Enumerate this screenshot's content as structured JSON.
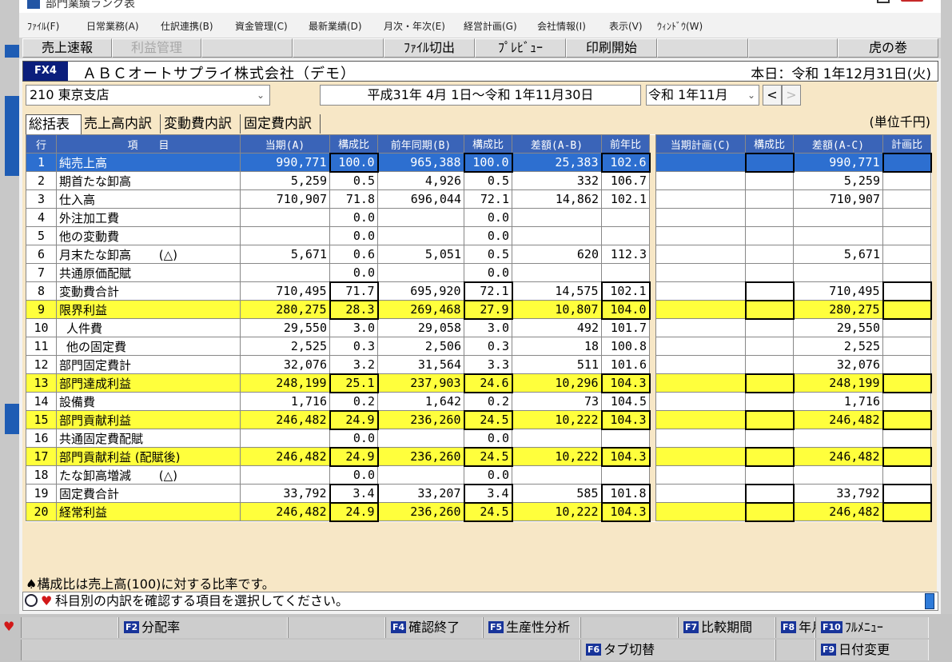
{
  "window": {
    "title": "部門業績ランク表",
    "menu": [
      "ﾌｧｲﾙ(F)",
      "日常業務(A)",
      "仕訳連携(B)",
      "資金管理(C)",
      "最新業績(D)",
      "月次・年次(E)",
      "経営計画(G)",
      "会社情報(I)",
      "表示(V)",
      "ｳｨﾝﾄﾞｳ(W)"
    ],
    "toolbar": {
      "sales_report": "売上速報",
      "profit_mgmt": "利益管理",
      "file_export": "ﾌｧｲﾙ切出",
      "preview": "ﾌﾟﾚﾋﾞｭｰ",
      "print": "印刷開始",
      "manual": "虎の巻"
    }
  },
  "company": {
    "badge": "FX4",
    "name": "ＡＢＣオートサプライ株式会社（デモ）",
    "today": "本日：令和 1年12月31日(火)"
  },
  "filters": {
    "branch": "210 東京支店",
    "period": "平成31年 4月 1日～令和 1年11月30日",
    "month": "令和 1年11月",
    "prev": "<",
    "next": ">"
  },
  "tabs": [
    "総括表",
    "売上高内訳",
    "変動費内訳",
    "固定費内訳"
  ],
  "unit": "(単位千円)",
  "table": {
    "headers": [
      "行",
      "項　　目",
      "当期(A)",
      "構成比",
      "前年同期(B)",
      "構成比",
      "差額(A-B)",
      "前年比",
      "当期計画(C)",
      "構成比",
      "差額(A-C)",
      "計画比"
    ],
    "rows": [
      {
        "no": "1",
        "item": "純売上高",
        "a": "990,771",
        "ar": "100.0",
        "b": "965,388",
        "br": "100.0",
        "ab": "25,383",
        "py": "102.6",
        "c": "",
        "cr": "",
        "ac": "990,771",
        "pr": "",
        "style": "sel"
      },
      {
        "no": "2",
        "item": "期首たな卸高",
        "a": "5,259",
        "ar": "0.5",
        "b": "4,926",
        "br": "0.5",
        "ab": "332",
        "py": "106.7",
        "c": "",
        "cr": "",
        "ac": "5,259",
        "pr": "",
        "style": ""
      },
      {
        "no": "3",
        "item": "仕入高",
        "a": "710,907",
        "ar": "71.8",
        "b": "696,044",
        "br": "72.1",
        "ab": "14,862",
        "py": "102.1",
        "c": "",
        "cr": "",
        "ac": "710,907",
        "pr": "",
        "style": ""
      },
      {
        "no": "4",
        "item": "外注加工費",
        "a": "",
        "ar": "0.0",
        "b": "",
        "br": "0.0",
        "ab": "",
        "py": "",
        "c": "",
        "cr": "",
        "ac": "",
        "pr": "",
        "style": ""
      },
      {
        "no": "5",
        "item": "他の変動費",
        "a": "",
        "ar": "0.0",
        "b": "",
        "br": "0.0",
        "ab": "",
        "py": "",
        "c": "",
        "cr": "",
        "ac": "",
        "pr": "",
        "style": ""
      },
      {
        "no": "6",
        "item": "月末たな卸高　　 (△)",
        "a": "5,671",
        "ar": "0.6",
        "b": "5,051",
        "br": "0.5",
        "ab": "620",
        "py": "112.3",
        "c": "",
        "cr": "",
        "ac": "5,671",
        "pr": "",
        "style": ""
      },
      {
        "no": "7",
        "item": "共通原価配賦",
        "a": "",
        "ar": "0.0",
        "b": "",
        "br": "0.0",
        "ab": "",
        "py": "",
        "c": "",
        "cr": "",
        "ac": "",
        "pr": "",
        "style": ""
      },
      {
        "no": "8",
        "item": "変動費合計",
        "a": "710,495",
        "ar": "71.7",
        "b": "695,920",
        "br": "72.1",
        "ab": "14,575",
        "py": "102.1",
        "c": "",
        "cr": "",
        "ac": "710,495",
        "pr": "",
        "style": "boxed"
      },
      {
        "no": "9",
        "item": "限界利益",
        "a": "280,275",
        "ar": "28.3",
        "b": "269,468",
        "br": "27.9",
        "ab": "10,807",
        "py": "104.0",
        "c": "",
        "cr": "",
        "ac": "280,275",
        "pr": "",
        "style": "yellow"
      },
      {
        "no": "10",
        "item": "人件費",
        "a": "29,550",
        "ar": "3.0",
        "b": "29,058",
        "br": "3.0",
        "ab": "492",
        "py": "101.7",
        "c": "",
        "cr": "",
        "ac": "29,550",
        "pr": "",
        "style": "indent"
      },
      {
        "no": "11",
        "item": "他の固定費",
        "a": "2,525",
        "ar": "0.3",
        "b": "2,506",
        "br": "0.3",
        "ab": "18",
        "py": "100.8",
        "c": "",
        "cr": "",
        "ac": "2,525",
        "pr": "",
        "style": "indent"
      },
      {
        "no": "12",
        "item": "部門固定費計",
        "a": "32,076",
        "ar": "3.2",
        "b": "31,564",
        "br": "3.3",
        "ab": "511",
        "py": "101.6",
        "c": "",
        "cr": "",
        "ac": "32,076",
        "pr": "",
        "style": ""
      },
      {
        "no": "13",
        "item": "部門達成利益",
        "a": "248,199",
        "ar": "25.1",
        "b": "237,903",
        "br": "24.6",
        "ab": "10,296",
        "py": "104.3",
        "c": "",
        "cr": "",
        "ac": "248,199",
        "pr": "",
        "style": "yellow"
      },
      {
        "no": "14",
        "item": "設備費",
        "a": "1,716",
        "ar": "0.2",
        "b": "1,642",
        "br": "0.2",
        "ab": "73",
        "py": "104.5",
        "c": "",
        "cr": "",
        "ac": "1,716",
        "pr": "",
        "style": ""
      },
      {
        "no": "15",
        "item": "部門貢献利益",
        "a": "246,482",
        "ar": "24.9",
        "b": "236,260",
        "br": "24.5",
        "ab": "10,222",
        "py": "104.3",
        "c": "",
        "cr": "",
        "ac": "246,482",
        "pr": "",
        "style": "yellow"
      },
      {
        "no": "16",
        "item": "共通固定費配賦",
        "a": "",
        "ar": "0.0",
        "b": "",
        "br": "0.0",
        "ab": "",
        "py": "",
        "c": "",
        "cr": "",
        "ac": "",
        "pr": "",
        "style": ""
      },
      {
        "no": "17",
        "item": "部門貢献利益 (配賦後)",
        "a": "246,482",
        "ar": "24.9",
        "b": "236,260",
        "br": "24.5",
        "ab": "10,222",
        "py": "104.3",
        "c": "",
        "cr": "",
        "ac": "246,482",
        "pr": "",
        "style": "yellow"
      },
      {
        "no": "18",
        "item": "たな卸高増減　　 (△)",
        "a": "",
        "ar": "0.0",
        "b": "",
        "br": "0.0",
        "ab": "",
        "py": "",
        "c": "",
        "cr": "",
        "ac": "",
        "pr": "",
        "style": ""
      },
      {
        "no": "19",
        "item": "固定費合計",
        "a": "33,792",
        "ar": "3.4",
        "b": "33,207",
        "br": "3.4",
        "ab": "585",
        "py": "101.8",
        "c": "",
        "cr": "",
        "ac": "33,792",
        "pr": "",
        "style": "boxed"
      },
      {
        "no": "20",
        "item": "経常利益",
        "a": "246,482",
        "ar": "24.9",
        "b": "236,260",
        "br": "24.5",
        "ab": "10,222",
        "py": "104.3",
        "c": "",
        "cr": "",
        "ac": "246,482",
        "pr": "",
        "style": "yellow"
      }
    ]
  },
  "note": "♠構成比は売上高(100)に対する比率です。",
  "status": "科目別の内訳を確認する項目を選択してください。",
  "fkeys": {
    "row1": [
      {
        "key": "F2",
        "label": "分配率"
      },
      {
        "key": "F4",
        "label": "確認終了"
      },
      {
        "key": "F5",
        "label": "生産性分析"
      },
      {
        "key": "F7",
        "label": "比較期間"
      },
      {
        "key": "F8",
        "label": "年月指定"
      },
      {
        "key": "F10",
        "label": "ﾌﾙﾒﾆｭｰ"
      }
    ],
    "row2": [
      {
        "key": "F6",
        "label": "タブ切替"
      },
      {
        "key": "F9",
        "label": "日付変更"
      }
    ]
  },
  "colors": {
    "header": "#3a64b8",
    "highlight": "#ffff3c",
    "selection": "#2d6fd0",
    "panel": "#f7e7c6",
    "fkey": "#18349a"
  }
}
